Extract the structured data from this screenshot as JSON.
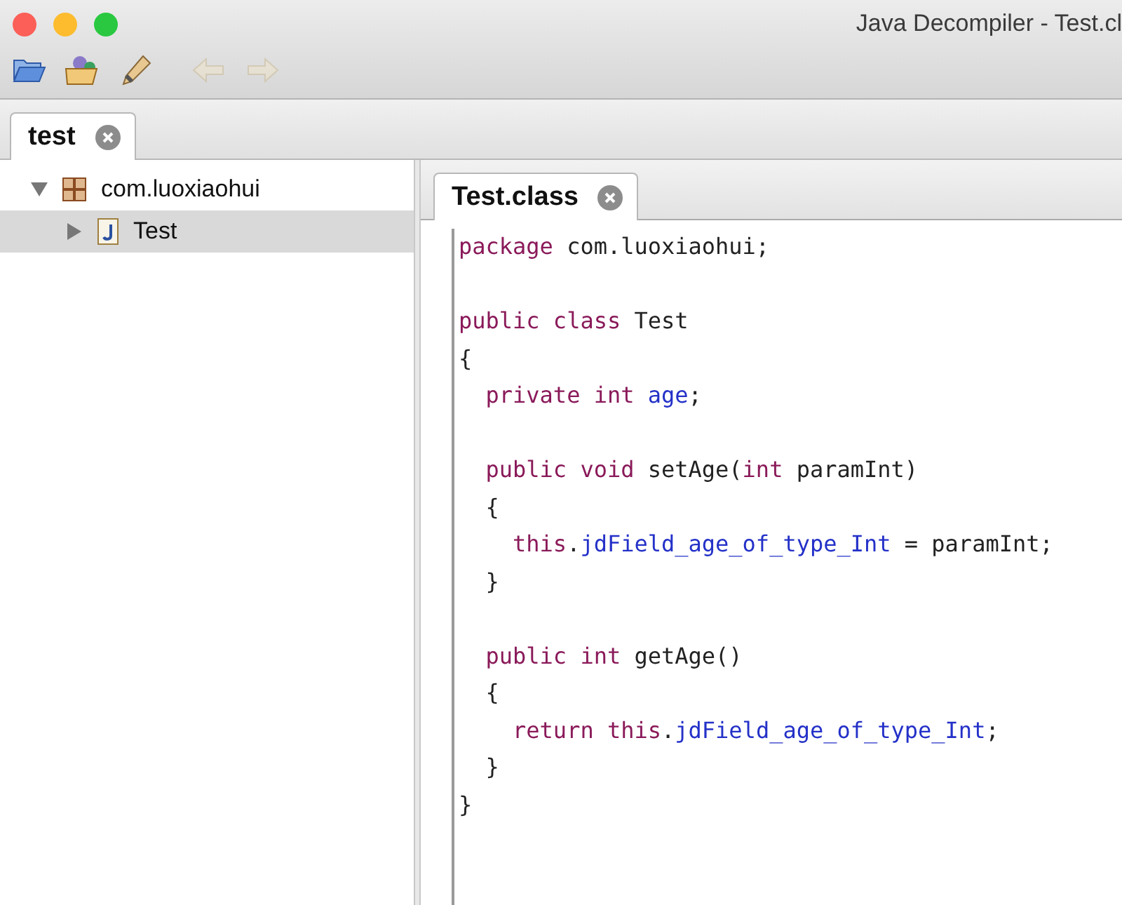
{
  "window": {
    "title": "Java Decompiler - Test.cl"
  },
  "toolbar": [
    {
      "kind": "open-folder",
      "disabled": false
    },
    {
      "kind": "type-folder",
      "disabled": false
    },
    {
      "kind": "pen",
      "disabled": false
    },
    {
      "kind": "back",
      "disabled": true
    },
    {
      "kind": "forward",
      "disabled": true
    }
  ],
  "file_tabs": [
    {
      "label": "test",
      "selected": true
    }
  ],
  "tree": [
    {
      "label": "com.luoxiaohui",
      "kind": "package",
      "expanded": true,
      "selected": false,
      "children": [
        {
          "label": "Test",
          "kind": "class",
          "expanded": false,
          "selected": true
        }
      ]
    }
  ],
  "editor_tabs": [
    {
      "label": "Test.class",
      "selected": true
    }
  ],
  "code": [
    {
      "kind": "code",
      "tokens": [
        {
          "text": "package",
          "kind": "keyword"
        },
        {
          "text": " com.luoxiaohui;",
          "kind": "plain"
        }
      ]
    },
    {
      "kind": "blank"
    },
    {
      "kind": "code",
      "tokens": [
        {
          "text": "public class",
          "kind": "keyword"
        },
        {
          "text": " Test",
          "kind": "plain"
        }
      ]
    },
    {
      "kind": "code",
      "tokens": [
        {
          "text": "{",
          "kind": "plain"
        }
      ]
    },
    {
      "kind": "code",
      "tokens": [
        {
          "text": "  private int ",
          "kind": "keyword"
        },
        {
          "text": "age",
          "kind": "field"
        },
        {
          "text": ";",
          "kind": "plain"
        }
      ]
    },
    {
      "kind": "blank"
    },
    {
      "kind": "code",
      "tokens": [
        {
          "text": "  public void",
          "kind": "keyword"
        },
        {
          "text": " setAge(",
          "kind": "plain"
        },
        {
          "text": "int",
          "kind": "keyword"
        },
        {
          "text": " paramInt)",
          "kind": "plain"
        }
      ]
    },
    {
      "kind": "code",
      "tokens": [
        {
          "text": "  {",
          "kind": "plain"
        }
      ]
    },
    {
      "kind": "code",
      "tokens": [
        {
          "text": "    this",
          "kind": "keyword"
        },
        {
          "text": ".",
          "kind": "plain"
        },
        {
          "text": "jdField_age_of_type_Int",
          "kind": "field"
        },
        {
          "text": " = paramInt;",
          "kind": "plain"
        }
      ]
    },
    {
      "kind": "code",
      "tokens": [
        {
          "text": "  }",
          "kind": "plain"
        }
      ]
    },
    {
      "kind": "blank"
    },
    {
      "kind": "code",
      "tokens": [
        {
          "text": "  public int",
          "kind": "keyword"
        },
        {
          "text": " getAge()",
          "kind": "plain"
        }
      ]
    },
    {
      "kind": "code",
      "tokens": [
        {
          "text": "  {",
          "kind": "plain"
        }
      ]
    },
    {
      "kind": "code",
      "tokens": [
        {
          "text": "    return this",
          "kind": "keyword"
        },
        {
          "text": ".",
          "kind": "plain"
        },
        {
          "text": "jdField_age_of_type_Int",
          "kind": "field"
        },
        {
          "text": ";",
          "kind": "plain"
        }
      ]
    },
    {
      "kind": "code",
      "tokens": [
        {
          "text": "  }",
          "kind": "plain"
        }
      ]
    },
    {
      "kind": "code",
      "tokens": [
        {
          "text": "}",
          "kind": "plain"
        }
      ]
    }
  ]
}
